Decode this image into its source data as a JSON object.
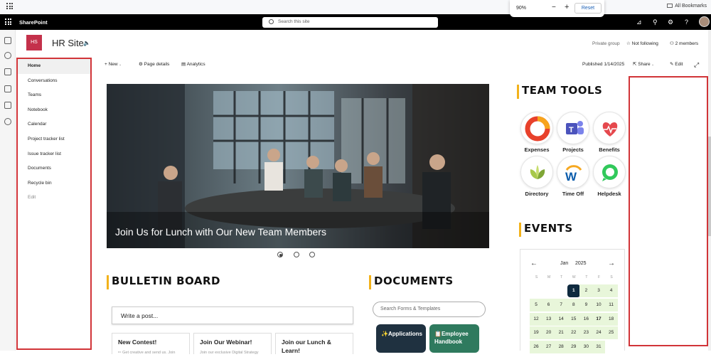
{
  "browser": {
    "zoom_level": "90%",
    "zoom_minus": "−",
    "zoom_plus": "+",
    "reset_label": "Reset",
    "all_bookmarks": "All Bookmarks"
  },
  "suite_bar": {
    "brand": "SharePoint",
    "search_placeholder": "Search this site"
  },
  "site": {
    "logo_text": "HS",
    "title": "HR Site",
    "privacy": "Private group",
    "follow": "Not following",
    "members": "2 members"
  },
  "nav": {
    "items": [
      {
        "label": "Home"
      },
      {
        "label": "Conversations"
      },
      {
        "label": "Teams"
      },
      {
        "label": "Notebook"
      },
      {
        "label": "Calendar"
      },
      {
        "label": "Project tracker list"
      },
      {
        "label": "Issue tracker list"
      },
      {
        "label": "Documents"
      },
      {
        "label": "Recycle bin"
      },
      {
        "label": "Edit"
      }
    ]
  },
  "command_bar": {
    "new": "New",
    "page_details": "Page details",
    "analytics": "Analytics",
    "published": "Published 1/14/2025",
    "share": "Share",
    "edit": "Edit"
  },
  "hero": {
    "caption": "Join Us for Lunch with Our New Team Members",
    "slide_count": 3,
    "active_slide": 1
  },
  "bulletin": {
    "heading": "BULLETIN BOARD",
    "post_placeholder": "Write a post...",
    "cards": [
      {
        "title": "New Contest!",
        "snippet": "✏ Get creative and send us. Join"
      },
      {
        "title": "Join Our Webinar!",
        "snippet": "Join our exclusive Digital Strategy"
      },
      {
        "title": "Join our Lunch & Learn!",
        "snippet": ""
      }
    ]
  },
  "documents": {
    "heading": "DOCUMENTS",
    "search_placeholder": "Search Forms & Templates",
    "buttons": [
      {
        "label": "✨Applications",
        "color": "#1f3140"
      },
      {
        "label": "📋Employee Handbook",
        "color": "#2f7a5e"
      }
    ]
  },
  "team_tools": {
    "heading": "TEAM TOOLS",
    "tools": [
      {
        "label": "Expenses",
        "icon": "expenses-icon"
      },
      {
        "label": "Projects",
        "icon": "teams-icon"
      },
      {
        "label": "Benefits",
        "icon": "heart-pulse-icon"
      },
      {
        "label": "Directory",
        "icon": "leaf-icon"
      },
      {
        "label": "Time Off",
        "icon": "workday-icon"
      },
      {
        "label": "Helpdesk",
        "icon": "chat-bubble-icon"
      }
    ]
  },
  "events": {
    "heading": "EVENTS",
    "calendar": {
      "month": "Jan",
      "year": "2025",
      "prev": "←",
      "next": "→",
      "weekdays": [
        "S",
        "M",
        "T",
        "W",
        "T",
        "F",
        "S"
      ],
      "weeks": [
        [
          "",
          "",
          "",
          "1",
          "2",
          "3",
          "4"
        ],
        [
          "5",
          "6",
          "7",
          "8",
          "9",
          "10",
          "11"
        ],
        [
          "12",
          "13",
          "14",
          "15",
          "16",
          "17",
          "18"
        ],
        [
          "19",
          "20",
          "21",
          "22",
          "23",
          "24",
          "25"
        ],
        [
          "26",
          "27",
          "28",
          "29",
          "30",
          "31",
          ""
        ]
      ],
      "today": "1",
      "bold_days": [
        "17"
      ],
      "event_color": "#e8f6da",
      "today_color": "#0f2a3f"
    }
  },
  "colors": {
    "accent_yellow": "#f2b21b",
    "site_logo": "#c4314b",
    "highlight_red": "#d13438"
  }
}
